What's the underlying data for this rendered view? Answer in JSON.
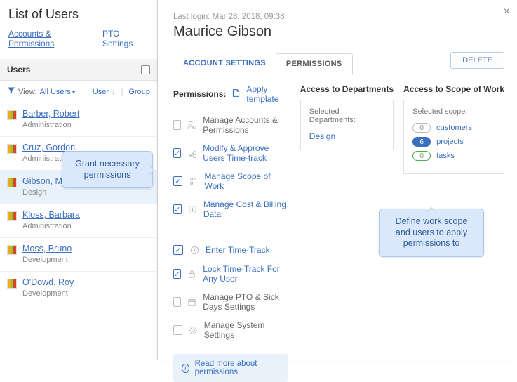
{
  "left": {
    "title": "List of Users",
    "tabs": {
      "accounts": "Accounts & Permissions",
      "pto": "PTO Settings"
    },
    "usersHeader": "Users",
    "view": {
      "label": "View:",
      "filter": "All Users",
      "userCol": "User",
      "groupCol": "Group"
    },
    "users": [
      {
        "name": "Barber, Robert",
        "dept": "Administration"
      },
      {
        "name": "Cruz, Gordon",
        "dept": "Administration"
      },
      {
        "name": "Gibson, Maurice",
        "dept": "Design"
      },
      {
        "name": "Kloss, Barbara",
        "dept": "Administration"
      },
      {
        "name": "Moss, Bruno",
        "dept": "Development"
      },
      {
        "name": "O'Dowd, Roy",
        "dept": "Development"
      }
    ]
  },
  "detail": {
    "lastLogin": "Last login: Mar 28, 2018, 09:38",
    "fullName": "Maurice Gibson",
    "tabs": {
      "settings": "ACCOUNT SETTINGS",
      "permissions": "PERMISSIONS"
    },
    "deleteLabel": "DELETE",
    "permHeader": "Permissions:",
    "applyTemplate": "Apply template",
    "perms1": [
      {
        "label": "Manage Accounts & Permissions",
        "on": false
      },
      {
        "label": "Modify & Approve Users Time-track",
        "on": true
      },
      {
        "label": "Manage Scope of Work",
        "on": true
      },
      {
        "label": "Manage Cost & Billing Data",
        "on": true
      }
    ],
    "perms2": [
      {
        "label": "Enter Time-Track",
        "on": true
      },
      {
        "label": "Lock Time-Track For Any User",
        "on": true
      },
      {
        "label": "Manage PTO & Sick Days Settings",
        "on": false
      },
      {
        "label": "Manage System Settings",
        "on": false
      }
    ],
    "readMore": "Read more about permissions",
    "dept": {
      "heading": "Access to Departments",
      "selLabel": "Selected Departments:",
      "value": "Design"
    },
    "scope": {
      "heading": "Access to Scope of Work",
      "selLabel": "Selected scope:",
      "rows": [
        {
          "count": "0",
          "label": "customers",
          "style": "grey"
        },
        {
          "count": "6",
          "label": "projects",
          "style": "blue"
        },
        {
          "count": "0",
          "label": "tasks",
          "style": "green"
        }
      ]
    }
  },
  "callouts": {
    "one": "Grant necessary permissions",
    "two": "Define work scope and users to apply permissions to"
  }
}
